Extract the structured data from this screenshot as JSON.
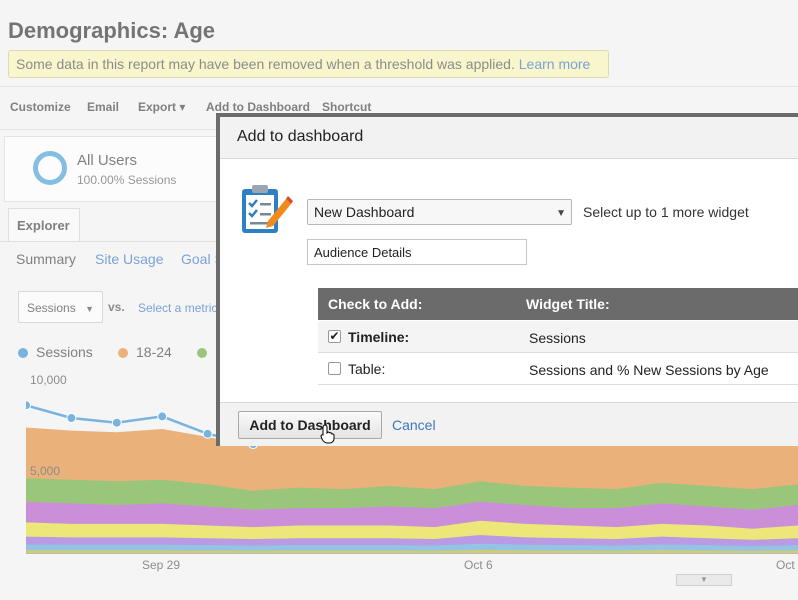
{
  "report": {
    "title": "Demographics: Age",
    "threshold_text": "Some data in this report may have been removed when a threshold was applied.",
    "learn_more": "Learn more",
    "toolbar": [
      "Customize",
      "Email",
      "Export ▾",
      "Add to Dashboard",
      "Shortcut"
    ],
    "segment": {
      "name": "All Users",
      "percent": "100.00% Sessions"
    },
    "explorer_tab": "Explorer",
    "subtabs": [
      "Summary",
      "Site Usage",
      "Goal S"
    ],
    "metric_select": "Sessions",
    "vs": "vs.",
    "select_metric": "Select a metric",
    "legend": [
      {
        "label": "Sessions",
        "color": "#3a8fcf"
      },
      {
        "label": "18-24",
        "color": "#e08c3c"
      },
      {
        "label": "",
        "color": "#6aac3d"
      }
    ]
  },
  "chart_data": {
    "type": "area",
    "y_ticks": [
      "10,000",
      "5,000"
    ],
    "x_ticks": [
      "Sep 29",
      "Oct 6",
      "Oct"
    ],
    "ylim": [
      0,
      11000
    ],
    "sessions": [
      9400,
      8600,
      8300,
      8700,
      7600,
      6950
    ],
    "stack_colors": [
      "#e08c3c",
      "#6aac3d",
      "#b35ac9",
      "#e5dc3a",
      "#9a6bd8",
      "#5fa8d8",
      "#b8b338"
    ],
    "stacks": {
      "orange": [
        8000,
        7800,
        7700,
        7900,
        7400,
        6800,
        7100,
        7000,
        7200,
        7000,
        7300,
        7100,
        7200,
        7000,
        7300,
        7100,
        7200,
        7300
      ],
      "green": [
        4800,
        4700,
        4600,
        4700,
        4400,
        4000,
        4200,
        4100,
        4300,
        4100,
        4600,
        4300,
        4200,
        4100,
        4500,
        4300,
        4100,
        4400
      ],
      "purple": [
        3300,
        3200,
        3100,
        3200,
        3000,
        2800,
        2900,
        2900,
        3000,
        2900,
        3300,
        3100,
        2900,
        2900,
        3200,
        3000,
        2800,
        3100
      ],
      "yellow": [
        2000,
        1900,
        1900,
        1900,
        1800,
        1700,
        1800,
        1800,
        1800,
        1700,
        2100,
        1900,
        1800,
        1700,
        1900,
        1800,
        1600,
        1800
      ],
      "violet": [
        1100,
        1050,
        1050,
        1050,
        1000,
        950,
        1000,
        1000,
        1000,
        950,
        1200,
        1050,
        1000,
        950,
        1100,
        1000,
        900,
        1000
      ],
      "blue": [
        600,
        580,
        580,
        580,
        560,
        540,
        560,
        560,
        560,
        540,
        650,
        580,
        560,
        540,
        600,
        560,
        500,
        560
      ],
      "olive": [
        250,
        240,
        240,
        240,
        230,
        220,
        230,
        230,
        230,
        220,
        260,
        240,
        230,
        220,
        250,
        230,
        210,
        230
      ]
    }
  },
  "modal": {
    "title": "Add to dashboard",
    "dashboard_select": "New Dashboard",
    "widget_hint": "Select up to 1 more widget",
    "dashboard_name": "Audience Details",
    "col_check": "Check to Add:",
    "col_title": "Widget Title:",
    "rows": [
      {
        "label": "Timeline:",
        "title": "Sessions",
        "checked": true
      },
      {
        "label": "Table:",
        "title": "Sessions and % New Sessions by Age",
        "checked": false
      }
    ],
    "add_button": "Add to Dashboard",
    "cancel": "Cancel"
  }
}
